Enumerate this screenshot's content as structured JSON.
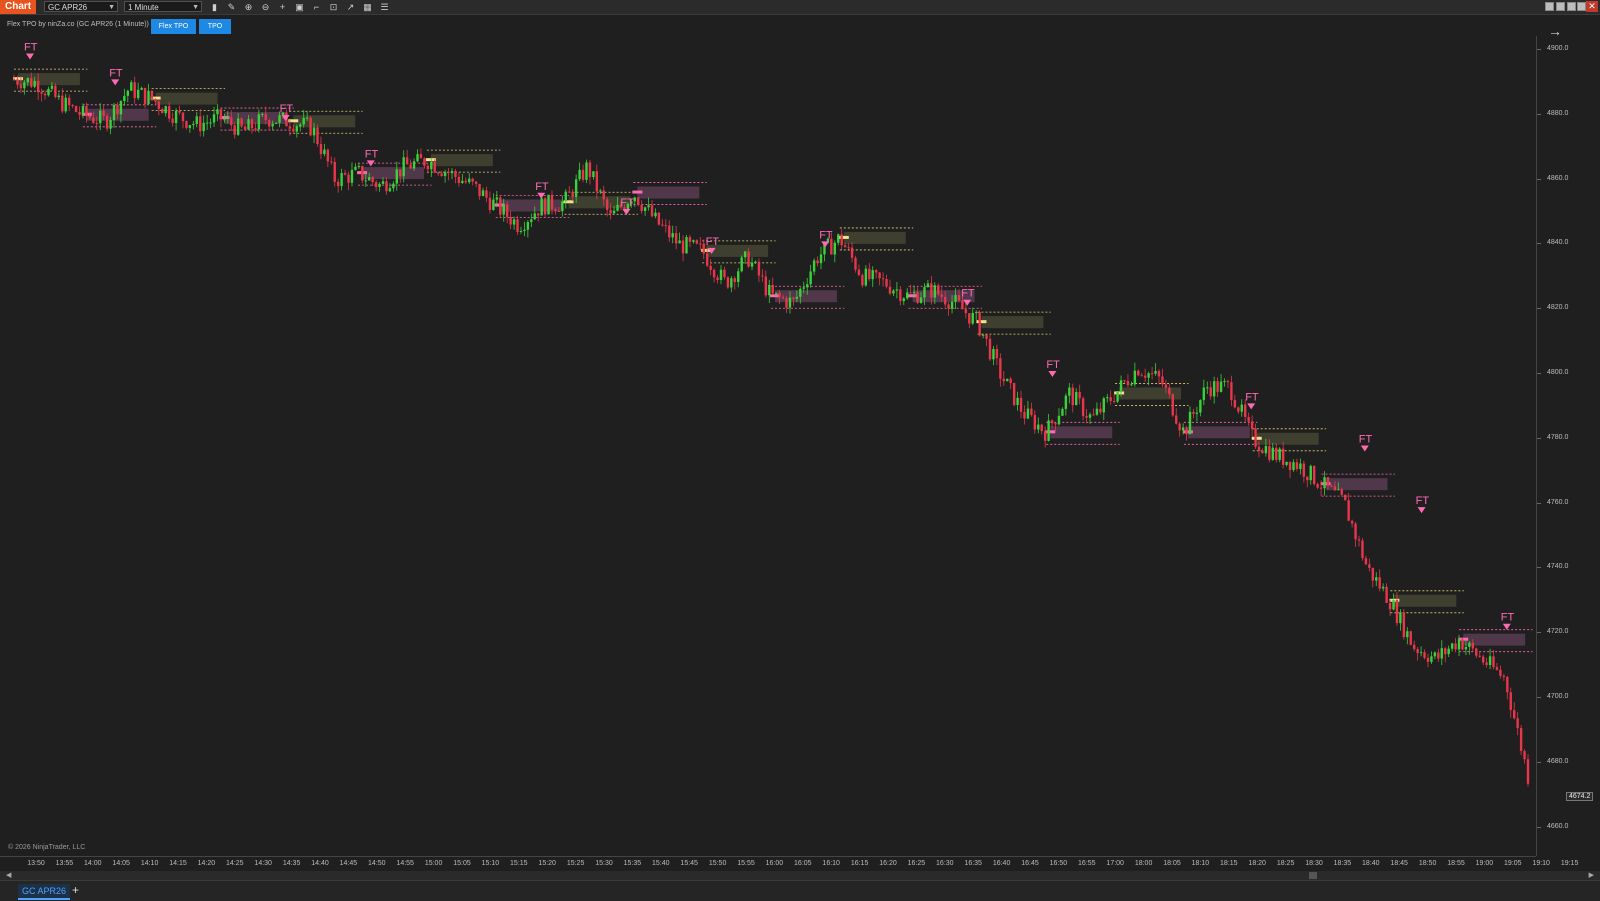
{
  "toolbar": {
    "chart_label": "Chart",
    "instrument": "GC APR26",
    "interval": "1 Minute",
    "tools": [
      {
        "icon": "bar-chart-icon",
        "glyph": "▮"
      },
      {
        "icon": "pencil-icon",
        "glyph": "✎"
      },
      {
        "icon": "zoom-in-icon",
        "glyph": "⊕"
      },
      {
        "icon": "zoom-out-icon",
        "glyph": "⊖"
      },
      {
        "icon": "crosshair-icon",
        "glyph": "+"
      },
      {
        "icon": "data-box-icon",
        "glyph": "▣"
      },
      {
        "icon": "snap-icon",
        "glyph": "⌐"
      },
      {
        "icon": "screenshot-icon",
        "glyph": "⊡"
      },
      {
        "icon": "strategy-icon",
        "glyph": "↗"
      },
      {
        "icon": "templates-icon",
        "glyph": "▦"
      },
      {
        "icon": "properties-icon",
        "glyph": "☰"
      }
    ]
  },
  "indicator": {
    "label": "Flex TPO by ninZa.co (GC APR26 (1 Minute))",
    "buttons": [
      "Flex TPO",
      "TPO"
    ]
  },
  "copyright": "© 2026 NinjaTrader, LLC",
  "bottom_tab": "GC APR26",
  "colors": {
    "up": "#3ad13a",
    "down": "#e8364b",
    "marker": "#ff69b4",
    "poc": "#f0e08c",
    "bg": "#1f1f1f"
  },
  "price_axis": {
    "ticks": [
      "4900.0",
      "4880.0",
      "4860.0",
      "4840.0",
      "4820.0",
      "4800.0",
      "4780.0",
      "4760.0",
      "4740.0",
      "4720.0",
      "4700.0",
      "4680.0",
      "4660.0"
    ],
    "last_price": "4674.2"
  },
  "time_axis": {
    "labels": [
      "13:50",
      "13:55",
      "14:00",
      "14:05",
      "14:10",
      "14:15",
      "14:20",
      "14:25",
      "14:30",
      "14:35",
      "14:40",
      "14:45",
      "14:50",
      "14:55",
      "15:00",
      "15:05",
      "15:10",
      "15:15",
      "15:20",
      "15:25",
      "15:30",
      "15:35",
      "15:40",
      "15:45",
      "15:50",
      "15:55",
      "16:00",
      "16:05",
      "16:10",
      "16:15",
      "16:20",
      "16:25",
      "16:30",
      "16:35",
      "16:40",
      "16:45",
      "16:50",
      "16:55",
      "17:00",
      "18:00",
      "18:05",
      "18:10",
      "18:15",
      "18:20",
      "18:25",
      "18:30",
      "18:35",
      "18:40",
      "18:45",
      "18:50",
      "18:55",
      "19:00",
      "19:05",
      "19:10",
      "19:15"
    ]
  },
  "chart_data": {
    "type": "candlestick",
    "marker_label": "FT",
    "path": [
      4891,
      4890,
      4884,
      4880,
      4878,
      4888,
      4885,
      4880,
      4877,
      4879,
      4875,
      4879,
      4878,
      4876,
      4860,
      4862,
      4858,
      4864,
      4866,
      4862,
      4858,
      4852,
      4846,
      4852,
      4853,
      4864,
      4848,
      4856,
      4847,
      4840,
      4838,
      4828,
      4836,
      4824,
      4822,
      4836,
      4842,
      4830,
      4828,
      4824,
      4826,
      4822,
      4816,
      4800,
      4788,
      4782,
      4794,
      4786,
      4794,
      4802,
      4798,
      4782,
      4796,
      4796,
      4780,
      4775,
      4772,
      4766,
      4760,
      4740,
      4730,
      4716,
      4712,
      4718,
      4712,
      4706,
      4676
    ],
    "ft_markers": [
      {
        "t": "13:50",
        "price": 4898
      },
      {
        "t": "14:05",
        "price": 4890
      },
      {
        "t": "14:35",
        "price": 4879
      },
      {
        "t": "14:50",
        "price": 4865
      },
      {
        "t": "15:20",
        "price": 4855
      },
      {
        "t": "15:35",
        "price": 4850
      },
      {
        "t": "15:50",
        "price": 4838
      },
      {
        "t": "16:10",
        "price": 4840
      },
      {
        "t": "16:35",
        "price": 4822
      },
      {
        "t": "16:50",
        "price": 4800
      },
      {
        "t": "18:20",
        "price": 4790
      },
      {
        "t": "18:40",
        "price": 4777
      },
      {
        "t": "18:50",
        "price": 4758
      },
      {
        "t": "19:05",
        "price": 4722
      }
    ]
  }
}
